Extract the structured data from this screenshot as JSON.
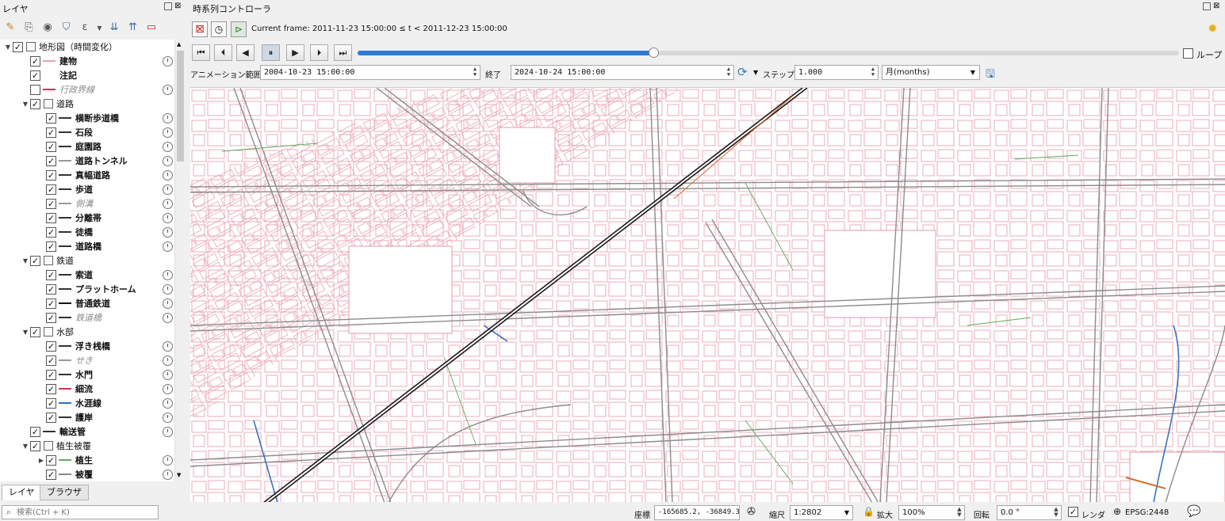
{
  "layers_panel": {
    "title": "レイヤ",
    "tree": [
      {
        "label": "地形図（時間変化）",
        "level": 0,
        "type": "group",
        "expanded": true,
        "checked": true,
        "italic": false,
        "symbol_color": "",
        "clock": false
      },
      {
        "label": "建物",
        "level": 1,
        "type": "layer",
        "checked": true,
        "italic": false,
        "symbol_color": "#e8a0b0",
        "clock": true
      },
      {
        "label": "注記",
        "level": 1,
        "type": "layer",
        "checked": true,
        "italic": false,
        "symbol_color": "",
        "clock": false
      },
      {
        "label": "行政界線",
        "level": 1,
        "type": "layer",
        "checked": false,
        "italic": true,
        "symbol_color": "#d03060",
        "clock": true
      },
      {
        "label": "道路",
        "level": 1,
        "type": "group",
        "expanded": true,
        "checked": true,
        "italic": false,
        "symbol_color": "",
        "clock": false
      },
      {
        "label": "横断歩道橋",
        "level": 2,
        "type": "layer",
        "checked": true,
        "italic": false,
        "symbol_color": "#333333",
        "clock": true
      },
      {
        "label": "石段",
        "level": 2,
        "type": "layer",
        "checked": true,
        "italic": false,
        "symbol_color": "#333333",
        "clock": true
      },
      {
        "label": "庭園路",
        "level": 2,
        "type": "layer",
        "checked": true,
        "italic": false,
        "symbol_color": "#333333",
        "clock": true
      },
      {
        "label": "道路トンネル",
        "level": 2,
        "type": "layer",
        "checked": true,
        "italic": false,
        "symbol_color": "#999999",
        "clock": true
      },
      {
        "label": "真幅道路",
        "level": 2,
        "type": "layer",
        "checked": true,
        "italic": false,
        "symbol_color": "#333333",
        "clock": true
      },
      {
        "label": "歩道",
        "level": 2,
        "type": "layer",
        "checked": true,
        "italic": false,
        "symbol_color": "#333333",
        "clock": true
      },
      {
        "label": "側溝",
        "level": 2,
        "type": "layer",
        "checked": true,
        "italic": true,
        "symbol_color": "#999999",
        "clock": true
      },
      {
        "label": "分離帯",
        "level": 2,
        "type": "layer",
        "checked": true,
        "italic": false,
        "symbol_color": "#333333",
        "clock": true
      },
      {
        "label": "徒橋",
        "level": 2,
        "type": "layer",
        "checked": true,
        "italic": false,
        "symbol_color": "#333333",
        "clock": true
      },
      {
        "label": "道路橋",
        "level": 2,
        "type": "layer",
        "checked": true,
        "italic": false,
        "symbol_color": "#333333",
        "clock": true
      },
      {
        "label": "鉄道",
        "level": 1,
        "type": "group",
        "expanded": true,
        "checked": true,
        "italic": false,
        "symbol_color": "",
        "clock": false
      },
      {
        "label": "索道",
        "level": 2,
        "type": "layer",
        "checked": true,
        "italic": false,
        "symbol_color": "#333333",
        "clock": true
      },
      {
        "label": "プラットホーム",
        "level": 2,
        "type": "layer",
        "checked": true,
        "italic": false,
        "symbol_color": "#333333",
        "clock": true
      },
      {
        "label": "普通鉄道",
        "level": 2,
        "type": "layer",
        "checked": true,
        "italic": false,
        "symbol_color": "#111111",
        "clock": true
      },
      {
        "label": "鉄道橋",
        "level": 2,
        "type": "layer",
        "checked": true,
        "italic": true,
        "symbol_color": "#333333",
        "clock": true
      },
      {
        "label": "水部",
        "level": 1,
        "type": "group",
        "expanded": true,
        "checked": true,
        "italic": false,
        "symbol_color": "",
        "clock": false
      },
      {
        "label": "浮き桟橋",
        "level": 2,
        "type": "layer",
        "checked": true,
        "italic": false,
        "symbol_color": "#333333",
        "clock": true
      },
      {
        "label": "せき",
        "level": 2,
        "type": "layer",
        "checked": true,
        "italic": true,
        "symbol_color": "#999999",
        "clock": true
      },
      {
        "label": "水門",
        "level": 2,
        "type": "layer",
        "checked": true,
        "italic": false,
        "symbol_color": "#333333",
        "clock": true
      },
      {
        "label": "細流",
        "level": 2,
        "type": "layer",
        "checked": true,
        "italic": false,
        "symbol_color": "#e03050",
        "clock": true
      },
      {
        "label": "水涯線",
        "level": 2,
        "type": "layer",
        "checked": true,
        "italic": false,
        "symbol_color": "#3070c0",
        "clock": true
      },
      {
        "label": "護岸",
        "level": 2,
        "type": "layer",
        "checked": true,
        "italic": false,
        "symbol_color": "#333333",
        "clock": true
      },
      {
        "label": "輸送管",
        "level": 1,
        "type": "layer",
        "checked": true,
        "italic": false,
        "symbol_color": "#333333",
        "clock": true
      },
      {
        "label": "植生被覆",
        "level": 1,
        "type": "group",
        "expanded": true,
        "checked": true,
        "italic": false,
        "symbol_color": "",
        "clock": false
      },
      {
        "label": "植生",
        "level": 2,
        "type": "group-collapsed",
        "checked": true,
        "italic": false,
        "symbol_color": "#66aa66",
        "clock": true
      },
      {
        "label": "被覆",
        "level": 2,
        "type": "layer",
        "checked": true,
        "italic": false,
        "symbol_color": "#888888",
        "clock": true
      }
    ],
    "tabs": [
      "レイヤ",
      "ブラウザ"
    ],
    "active_tab": 0
  },
  "temporal": {
    "title": "時系列コントローラ",
    "current_frame": "Current frame: 2011-11-23 15:00:00 ≤ t < 2011-12-23 15:00:00",
    "slider_fraction": 0.36,
    "loop_label": "ループ",
    "range_label": "アニメーション範囲",
    "start": "2004-10-23 15:00:00",
    "end_label": "終了",
    "end": "2024-10-24 15:00:00",
    "step_label": "ステップ",
    "step_value": "1.000",
    "unit": "月(months)"
  },
  "statusbar": {
    "search_placeholder": "検索(Ctrl + K)",
    "coord_label": "座標",
    "coord": "-165685.2, -36849.3",
    "scale_label": "縮尺",
    "scale": "1:2802",
    "magnifier_label": "拡大",
    "magnifier": "100%",
    "rotation_label": "回転",
    "rotation": "0.0 °",
    "render_label": "レンダ",
    "crs": "EPSG:2448"
  },
  "colors": {
    "building": "#e69aa8",
    "road": "#8c8c8c",
    "railway": "#1a1a1a",
    "vegetation": "#5aaa5a",
    "water": "#3a72c0",
    "slider": "#2f78d4"
  }
}
